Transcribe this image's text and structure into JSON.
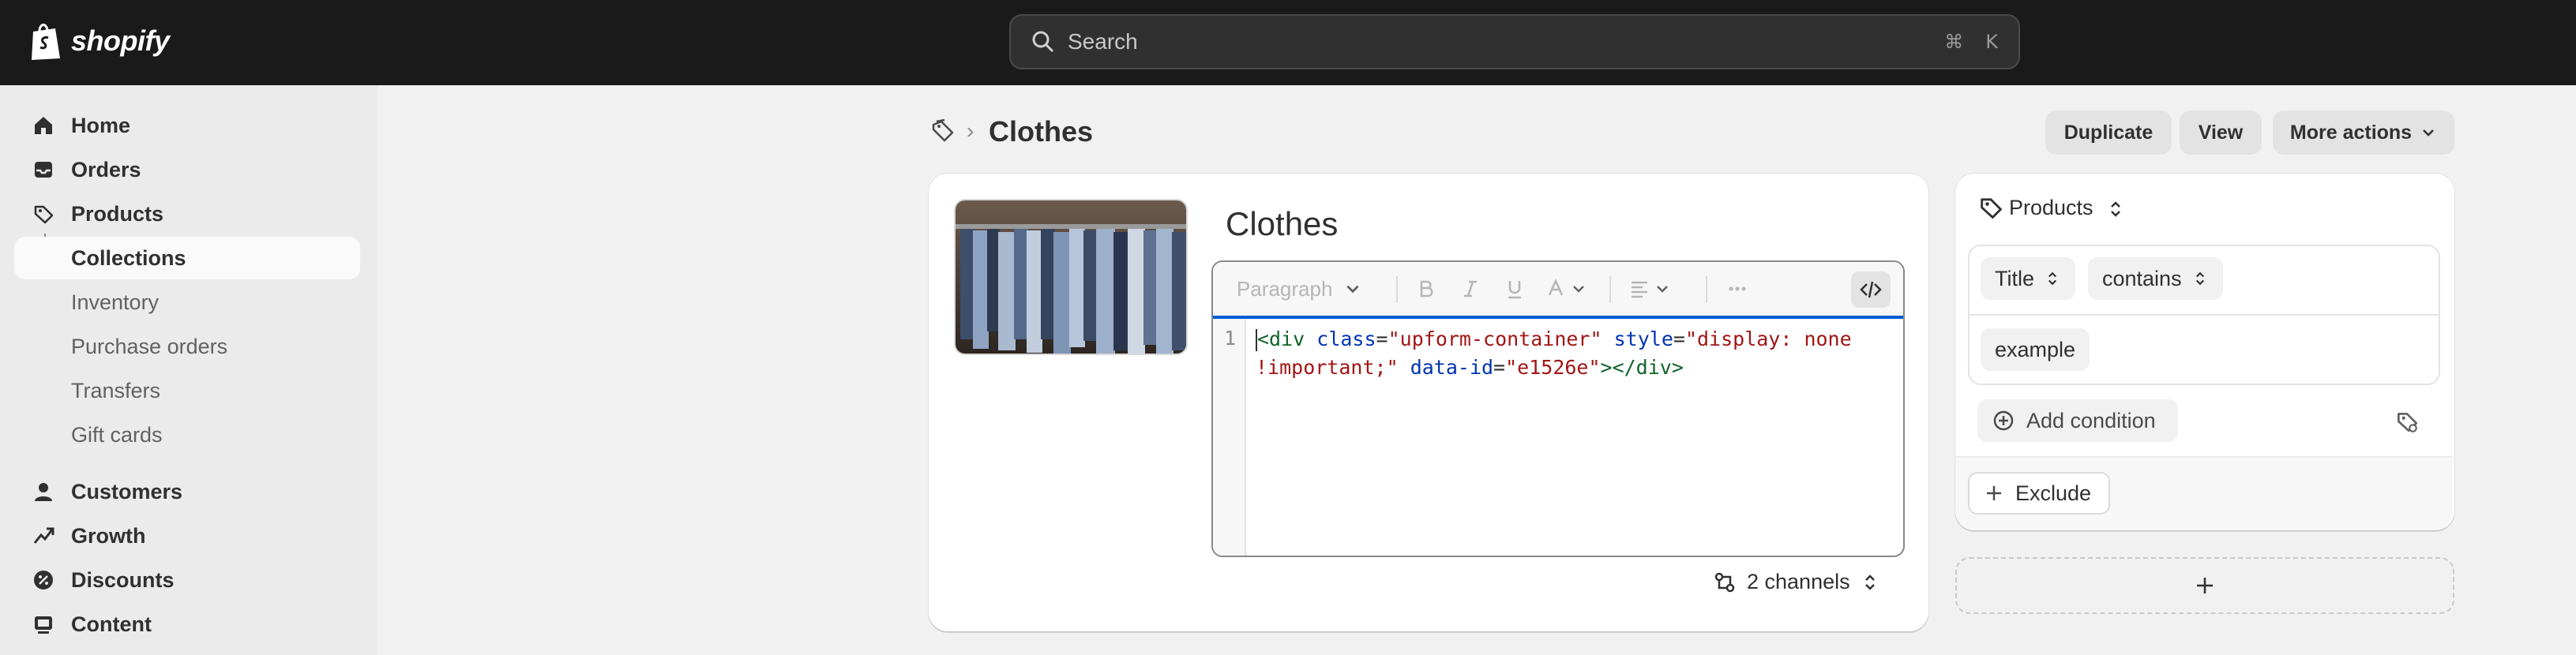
{
  "brand": {
    "logo_text": "shopify"
  },
  "search": {
    "placeholder": "Search",
    "shortcut_cmd": "⌘",
    "shortcut_key": "K"
  },
  "sidebar": {
    "items": [
      {
        "label": "Home",
        "icon": "home-icon"
      },
      {
        "label": "Orders",
        "icon": "inbox-icon"
      },
      {
        "label": "Products",
        "icon": "tag-icon"
      },
      {
        "label": "Collections",
        "active": true
      },
      {
        "label": "Inventory"
      },
      {
        "label": "Purchase orders"
      },
      {
        "label": "Transfers"
      },
      {
        "label": "Gift cards"
      },
      {
        "label": "Customers",
        "icon": "person-icon"
      },
      {
        "label": "Growth",
        "icon": "growth-icon"
      },
      {
        "label": "Discounts",
        "icon": "discount-icon"
      },
      {
        "label": "Content",
        "icon": "content-icon"
      }
    ]
  },
  "header": {
    "title": "Clothes",
    "buttons": {
      "duplicate": "Duplicate",
      "view": "View",
      "more": "More actions"
    }
  },
  "collection": {
    "title": "Clothes",
    "editor": {
      "format": "Paragraph",
      "line_number": "1",
      "code": {
        "open": "<div",
        "attr_class": "class",
        "val_class": "\"upform-container\"",
        "attr_style": "style",
        "val_style": "\"display: none !important;\"",
        "attr_data": "data-id",
        "val_data": "\"e1526e\"",
        "close": "></div>"
      }
    },
    "channels": "2 channels"
  },
  "conditions": {
    "title": "Products",
    "field": "Title",
    "operator": "contains",
    "value": "example",
    "add_label": "Add condition",
    "exclude_label": "Exclude"
  },
  "colors": {
    "accent": "#005bd3",
    "topbar": "#1a1a1a",
    "sidebar": "#ebebeb"
  }
}
